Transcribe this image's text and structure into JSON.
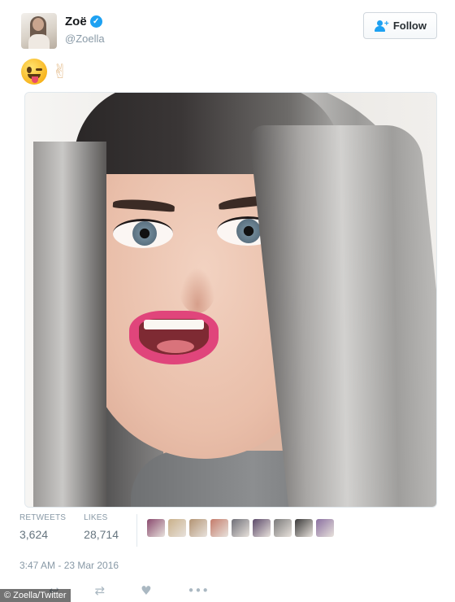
{
  "user": {
    "name": "Zoë",
    "handle": "@Zoella",
    "follow_label": "Follow",
    "verified": true
  },
  "tweet": {
    "emojis": [
      "winking-face-with-tongue",
      "victory-hand"
    ],
    "emoji_peace": "✌"
  },
  "stats": {
    "retweets_label": "RETWEETS",
    "retweets_value": "3,624",
    "likes_label": "LIKES",
    "likes_value": "28,714",
    "liker_avatar_colors": [
      "#8a4a6e",
      "#c9b08a",
      "#b39473",
      "#c47b6a",
      "#6f6f78",
      "#5c4a6a",
      "#7a7a7a",
      "#3a3a3a",
      "#8a6fa0"
    ]
  },
  "timestamp": "3:47 AM - 23 Mar 2016",
  "credit": "© Zoella/Twitter",
  "actions": {
    "reply_icon": "reply-icon",
    "retweet_icon": "retweet-icon",
    "like_icon": "heart-icon",
    "more_icon": "more-icon"
  },
  "colors": {
    "accent": "#1da1f2",
    "muted": "#8899a6"
  }
}
